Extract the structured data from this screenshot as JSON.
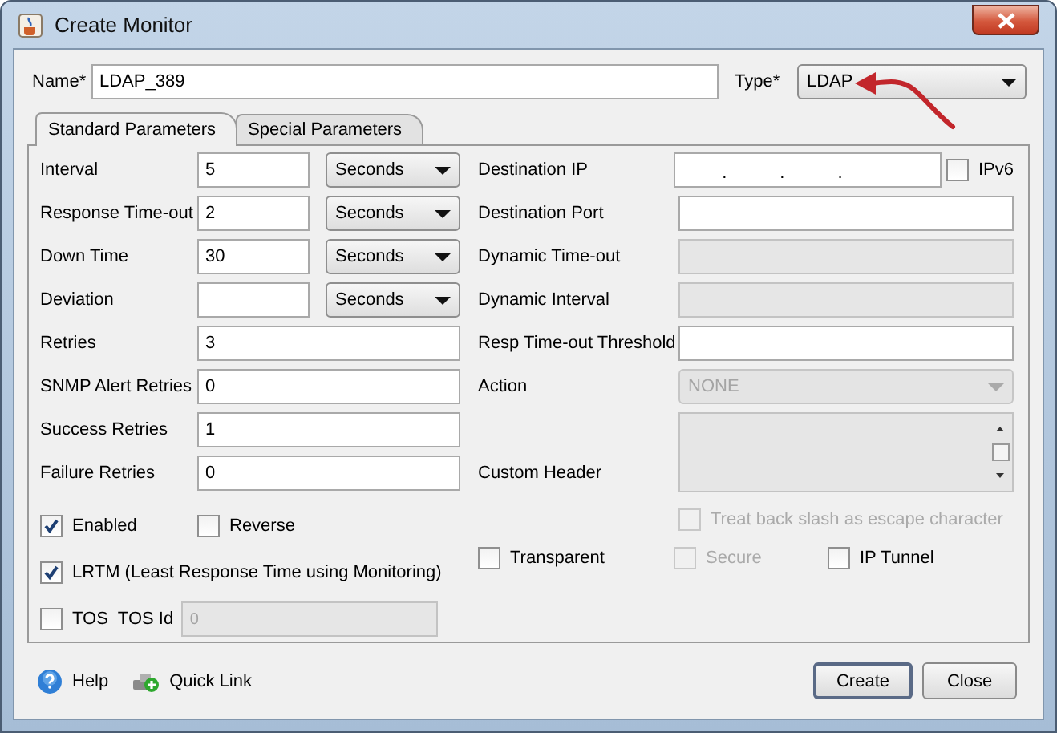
{
  "window": {
    "title": "Create Monitor"
  },
  "name_field": {
    "label": "Name*",
    "value": "LDAP_389"
  },
  "type_field": {
    "label": "Type*",
    "value": "LDAP"
  },
  "tabs": [
    {
      "label": "Standard Parameters",
      "selected": true
    },
    {
      "label": "Special Parameters",
      "selected": false
    }
  ],
  "left_fields": [
    {
      "kind": "text_unit",
      "label": "Interval",
      "value": "5",
      "unit": "Seconds"
    },
    {
      "kind": "text_unit",
      "label": "Response Time-out",
      "value": "2",
      "unit": "Seconds"
    },
    {
      "kind": "text_unit",
      "label": "Down Time",
      "value": "30",
      "unit": "Seconds"
    },
    {
      "kind": "text_unit",
      "label": "Deviation",
      "unit": "Seconds"
    },
    {
      "kind": "text",
      "label": "Retries",
      "value": "3"
    },
    {
      "kind": "text",
      "label": "SNMP Alert Retries",
      "value": "0"
    },
    {
      "kind": "text",
      "label": "Success Retries",
      "value": "1"
    },
    {
      "kind": "text",
      "label": "Failure Retries",
      "value": "0"
    }
  ],
  "right_fields": [
    {
      "kind": "ip",
      "label": "Destination IP",
      "separators": [
        ".",
        ".",
        "."
      ],
      "disabled": false,
      "checkbox": {
        "label": "IPv6",
        "checked": false
      }
    },
    {
      "kind": "text",
      "label": "Destination Port",
      "disabled": false
    },
    {
      "kind": "text",
      "label": "Dynamic Time-out",
      "disabled": true
    },
    {
      "kind": "text",
      "label": "Dynamic Interval",
      "disabled": true
    },
    {
      "kind": "text",
      "label": "Resp Time-out Threshold",
      "disabled": false
    },
    {
      "kind": "select",
      "label": "Action",
      "value": "NONE",
      "disabled": true
    },
    {
      "kind": "textarea",
      "label": "Custom Header",
      "disabled": true
    }
  ],
  "left_options": [
    [
      {
        "kind": "checkbox",
        "label": "Enabled",
        "checked": true,
        "disabled": false
      },
      {
        "kind": "checkbox",
        "label": "Reverse",
        "checked": false,
        "disabled": false
      }
    ],
    [
      {
        "kind": "checkbox",
        "label": "LRTM (Least Response Time using Monitoring)",
        "checked": true,
        "disabled": false
      }
    ],
    [
      {
        "kind": "checkbox",
        "label": "TOS",
        "checked": false,
        "disabled": false
      },
      {
        "kind": "field",
        "label": "TOS Id",
        "value": "0",
        "disabled": true
      }
    ]
  ],
  "right_options": [
    [
      {
        "kind": "checkbox",
        "label": "Treat back slash as escape character",
        "checked": false,
        "disabled": true
      }
    ],
    [
      {
        "kind": "checkbox",
        "label": "Transparent",
        "checked": false,
        "disabled": false
      },
      {
        "kind": "checkbox",
        "label": "Secure",
        "checked": false,
        "disabled": true
      },
      {
        "kind": "checkbox",
        "label": "IP Tunnel",
        "checked": false,
        "disabled": false
      }
    ]
  ],
  "footer_links": [
    {
      "kind": "help",
      "label": "Help"
    },
    {
      "kind": "quick_link",
      "label": "Quick Link"
    }
  ],
  "buttons": [
    {
      "label": "Create",
      "default": true
    },
    {
      "label": "Close",
      "default": false
    }
  ]
}
